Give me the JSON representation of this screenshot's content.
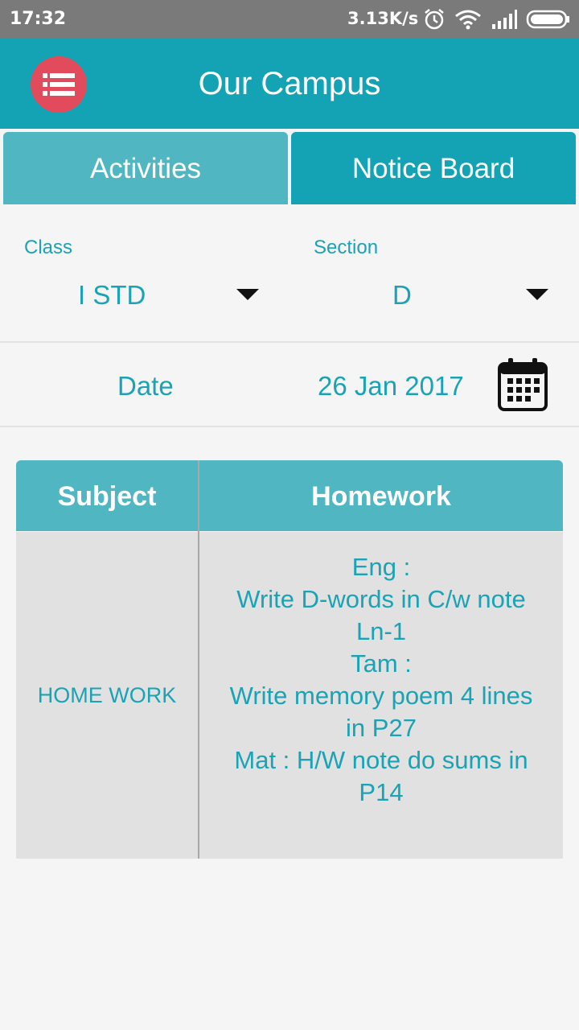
{
  "status_bar": {
    "time": "17:32",
    "net_speed": "3.13K/s",
    "icons": [
      "alarm-icon",
      "wifi-icon",
      "signal-icon",
      "battery-icon"
    ]
  },
  "app_bar": {
    "title": "Our Campus",
    "menu_icon": "list-menu-icon"
  },
  "tabs": [
    {
      "label": "Activities"
    },
    {
      "label": "Notice Board"
    }
  ],
  "filters": {
    "class_label": "Class",
    "class_value": "I STD",
    "section_label": "Section",
    "section_value": "D",
    "date_label": "Date",
    "date_value": "26 Jan 2017"
  },
  "table": {
    "headers": [
      "Subject",
      "Homework"
    ],
    "rows": [
      {
        "subject": "HOME WORK",
        "homework_lines": [
          "Eng :",
          "Write D-words in C/w note",
          "Ln-1",
          "Tam :",
          "Write memory poem 4 lines",
          "in P27",
          "Mat : H/W note do sums in",
          "P14"
        ]
      }
    ]
  },
  "colors": {
    "primary": "#13a3b4",
    "tab_light": "#50b6c2",
    "menu_button": "#e24b5b",
    "text_accent": "#1aa3b5"
  }
}
